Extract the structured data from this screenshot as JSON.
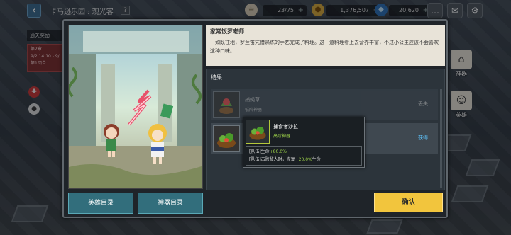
{
  "header": {
    "title": "卡马逊乐园 : 观光客",
    "help": "?",
    "resources": [
      {
        "icon": "coffee-icon",
        "value": "23/75",
        "plus": "+"
      },
      {
        "icon": "gold-coin-icon",
        "value": "1,376,507",
        "plus": "+"
      },
      {
        "icon": "gem-icon",
        "value": "20,620",
        "plus": "+"
      }
    ]
  },
  "side_left": {
    "label": "通关奖励",
    "event_line1": "第2章",
    "event_line2": "9/2 14:10 - 9/",
    "event_line3": "第1回合"
  },
  "side_menu": [
    {
      "label": "神器",
      "icon": "relic-icon"
    },
    {
      "label": "英雄",
      "icon": "hero-icon"
    }
  ],
  "dialog": {
    "story_title": "家常饭罗老师",
    "story_text": "一如既往地，罗兰笛凭借熟练的手艺完成了料理。这一道料理看上去营养丰富，不过小公主应该不会喜欢这种口味。",
    "result_label": "结果",
    "rows": [
      {
        "name": "捕蝇草",
        "sub": "低阶神器",
        "state": "丢失"
      },
      {
        "name": "",
        "sub": "",
        "state": "获得"
      }
    ],
    "buttons": {
      "hero_list": "英雄目录",
      "relic_list": "神器目录",
      "confirm": "确认"
    }
  },
  "tooltip": {
    "name": "捕食者沙拉",
    "type": "高阶神器",
    "effect1_prefix": "[队伍]生命",
    "effect1_value": "+80.0%",
    "effect2_prefix": "[队伍]击败敌人时，恢复",
    "effect2_value": "+20.0%",
    "effect2_suffix": "生命"
  },
  "colors": {
    "confirm": "#f2c53d",
    "secondary_button": "#326e7c",
    "gain": "#5ec6ff",
    "highlight": "#9fd54a"
  }
}
